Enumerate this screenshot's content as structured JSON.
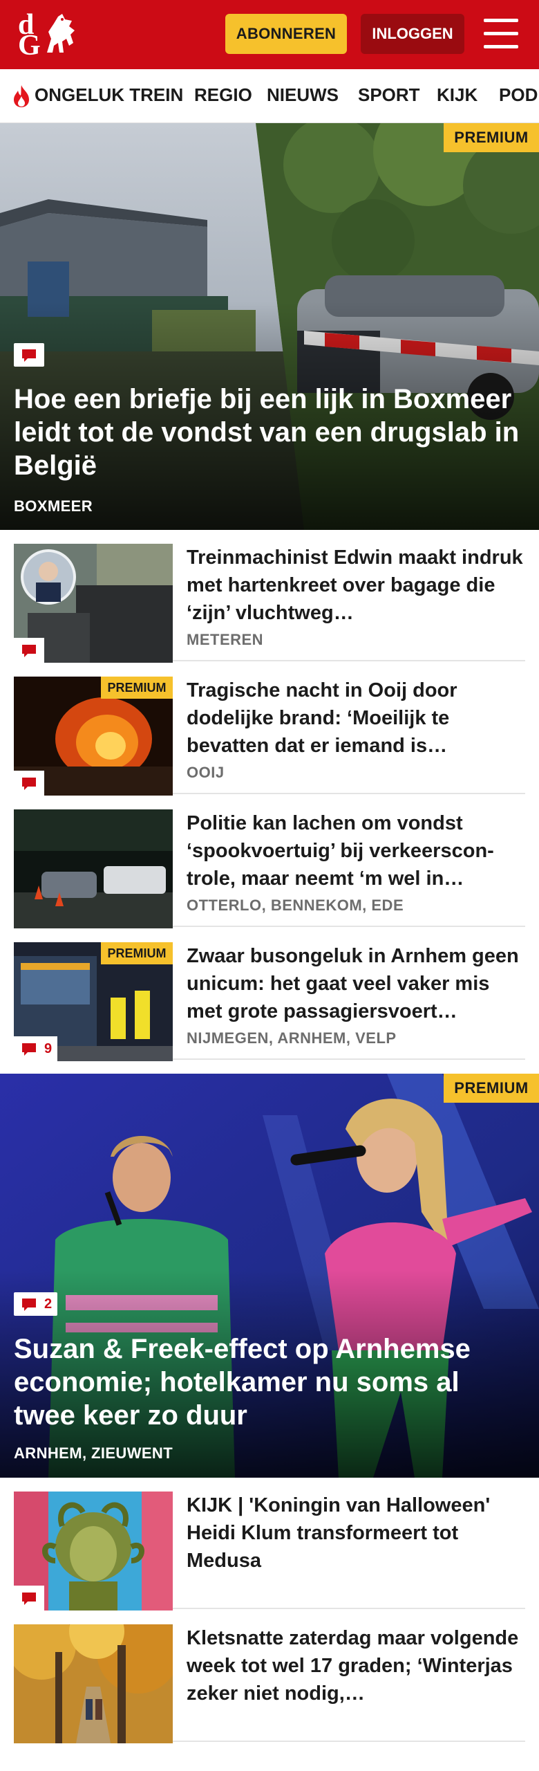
{
  "header": {
    "subscribe_label": "ABONNEREN",
    "login_label": "INLOGGEN",
    "logo_text_top": "d",
    "logo_text_bottom": "G",
    "menu_icon": "hamburger-icon",
    "brand_color": "#cc0b15"
  },
  "nav": {
    "items": [
      {
        "label": "ONGELUK TREIN",
        "icon": "flame-icon"
      },
      {
        "label": "REGIO"
      },
      {
        "label": "NIEUWS"
      },
      {
        "label": "SPORT"
      },
      {
        "label": "KIJK"
      },
      {
        "label": "POD"
      }
    ]
  },
  "hero1": {
    "premium": "PREMIUM",
    "title": "Hoe een briefje bij een lijk in Boxmeer leidt tot de vondst van een drugslab in België",
    "location": "BOXMEER",
    "comment_icon": "comment-icon"
  },
  "articles": [
    {
      "title": "Treinmachinist Edwin maakt indruk met hartenkreet over bagage die ‘zijn’ vluchtweg…",
      "location": "METEREN",
      "premium": "",
      "comments": ""
    },
    {
      "title": "Tragische nacht in Ooij door dodelijke brand: ‘Moeilijk te bevatten dat er iemand is…",
      "location": "OOIJ",
      "premium": "PREMIUM",
      "comments": ""
    },
    {
      "title": "Politie kan lachen om vondst ‘spookvoertuig’ bij verkeerscon-trole, maar neemt ‘m wel in…",
      "location": "OTTERLO, BENNEKOM, EDE",
      "premium": "",
      "comments": ""
    },
    {
      "title": "Zwaar busongeluk in Arnhem geen unicum: het gaat veel vaker mis met grote passagiersvoert…",
      "location": "NIJMEGEN, ARNHEM, VELP",
      "premium": "PREMIUM",
      "comments": "9"
    }
  ],
  "hero2": {
    "premium": "PREMIUM",
    "title": "Suzan & Freek-effect op Arnhemse economie; hotelkamer nu soms al twee keer zo duur",
    "location": "ARNHEM, ZIEUWENT",
    "comments": "2"
  },
  "articles2": [
    {
      "title": "KIJK | 'Koningin van Halloween' Heidi Klum transformeert tot Medusa",
      "location": ""
    },
    {
      "title": "Kletsnatte zaterdag maar volgende week tot wel 17 graden; ‘Winterjas zeker niet nodig,…",
      "location": ""
    }
  ],
  "colors": {
    "premium_bg": "#f6c12c",
    "login_bg": "#9a0b10",
    "location_grey": "#6d6d6d"
  }
}
